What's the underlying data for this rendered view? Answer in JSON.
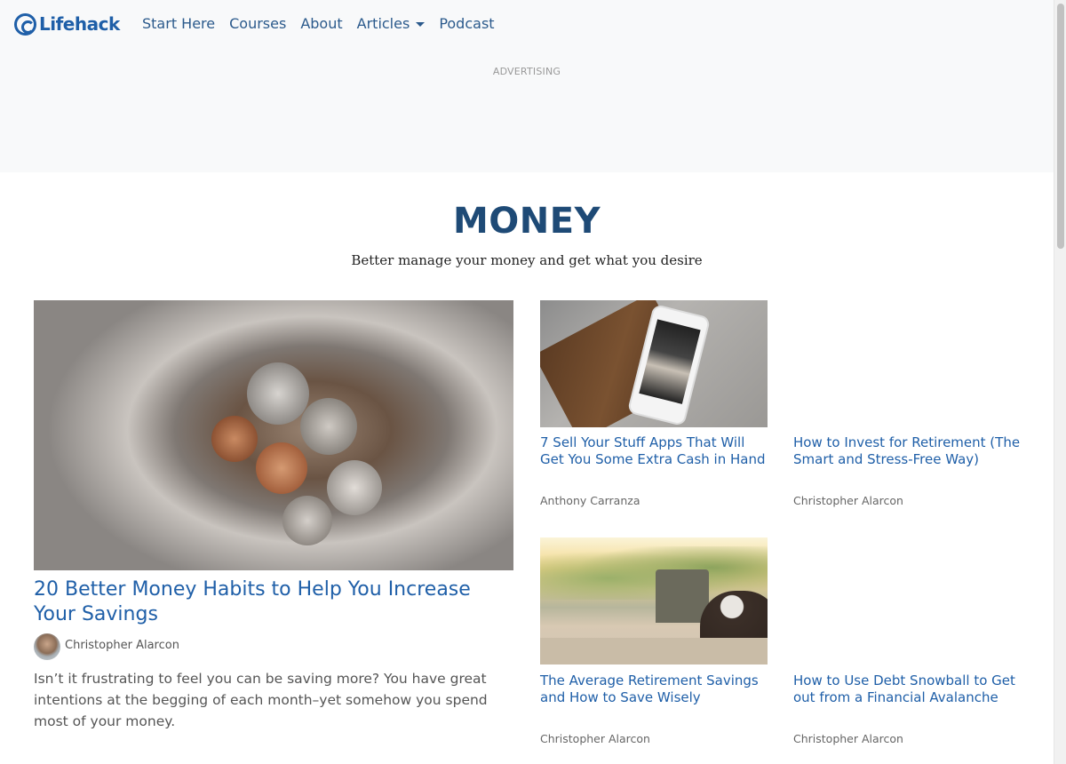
{
  "header": {
    "logo_text": "Lifehack",
    "nav": [
      {
        "label": "Start Here"
      },
      {
        "label": "Courses"
      },
      {
        "label": "About"
      },
      {
        "label": "Articles",
        "has_dropdown": true
      },
      {
        "label": "Podcast"
      }
    ],
    "ad_label": "ADVERTISING"
  },
  "category": {
    "title": "MONEY",
    "subtitle": "Better manage your money and get what you desire"
  },
  "featured": {
    "title": "20 Better Money Habits to Help You Increase Your Savings",
    "author": "Christopher Alarcon",
    "excerpt": "Isn’t it frustrating to feel you can be saving more? You have great intentions at the begging of each month–yet somehow you spend most of your money."
  },
  "articles": [
    {
      "title": "7 Sell Your Stuff Apps That Will Get You Some Extra Cash in Hand",
      "author": "Anthony Carranza"
    },
    {
      "title": "How to Invest for Retirement (The Smart and Stress-Free Way)",
      "author": "Christopher Alarcon"
    },
    {
      "title": "The Average Retirement Savings and How to Save Wisely",
      "author": "Christopher Alarcon"
    },
    {
      "title": "How to Use Debt Snowball to Get out from a Financial Avalanche",
      "author": "Christopher Alarcon"
    }
  ],
  "colors": {
    "brand": "#1f5fa8",
    "heading": "#1e4a76",
    "link": "#1f5fa8",
    "topbar_bg": "#f8f9fa"
  }
}
